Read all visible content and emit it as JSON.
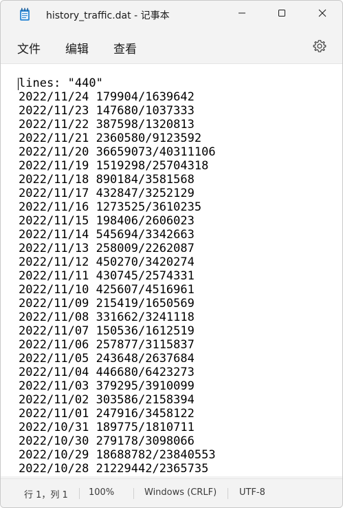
{
  "window": {
    "title": "history_traffic.dat - 记事本"
  },
  "menu": {
    "file": "文件",
    "edit": "编辑",
    "view": "查看"
  },
  "icons": {
    "app": "notepad-icon",
    "minimize": "minimize-icon",
    "maximize": "maximize-icon",
    "close": "close-icon",
    "settings": "gear-icon"
  },
  "editor": {
    "lines": [
      "lines: \"440\"",
      "2022/11/24 179904/1639642",
      "2022/11/23 147680/1037333",
      "2022/11/22 387598/1320813",
      "2022/11/21 2360580/9123592",
      "2022/11/20 36659073/40311106",
      "2022/11/19 1519298/25704318",
      "2022/11/18 890184/3581568",
      "2022/11/17 432847/3252129",
      "2022/11/16 1273525/3610235",
      "2022/11/15 198406/2606023",
      "2022/11/14 545694/3342663",
      "2022/11/13 258009/2262087",
      "2022/11/12 450270/3420274",
      "2022/11/11 430745/2574331",
      "2022/11/10 425607/4516961",
      "2022/11/09 215419/1650569",
      "2022/11/08 331662/3241118",
      "2022/11/07 150536/1612519",
      "2022/11/06 257877/3115837",
      "2022/11/05 243648/2637684",
      "2022/11/04 446680/6423273",
      "2022/11/03 379295/3910099",
      "2022/11/02 303586/2158394",
      "2022/11/01 247916/3458122",
      "2022/10/31 189775/1810711",
      "2022/10/30 279178/3098066",
      "2022/10/29 18688782/23840553",
      "2022/10/28 21229442/2365735"
    ]
  },
  "status": {
    "position": "行 1，列 1",
    "zoom": "100%",
    "line_ending": "Windows (CRLF)",
    "encoding": "UTF-8"
  }
}
